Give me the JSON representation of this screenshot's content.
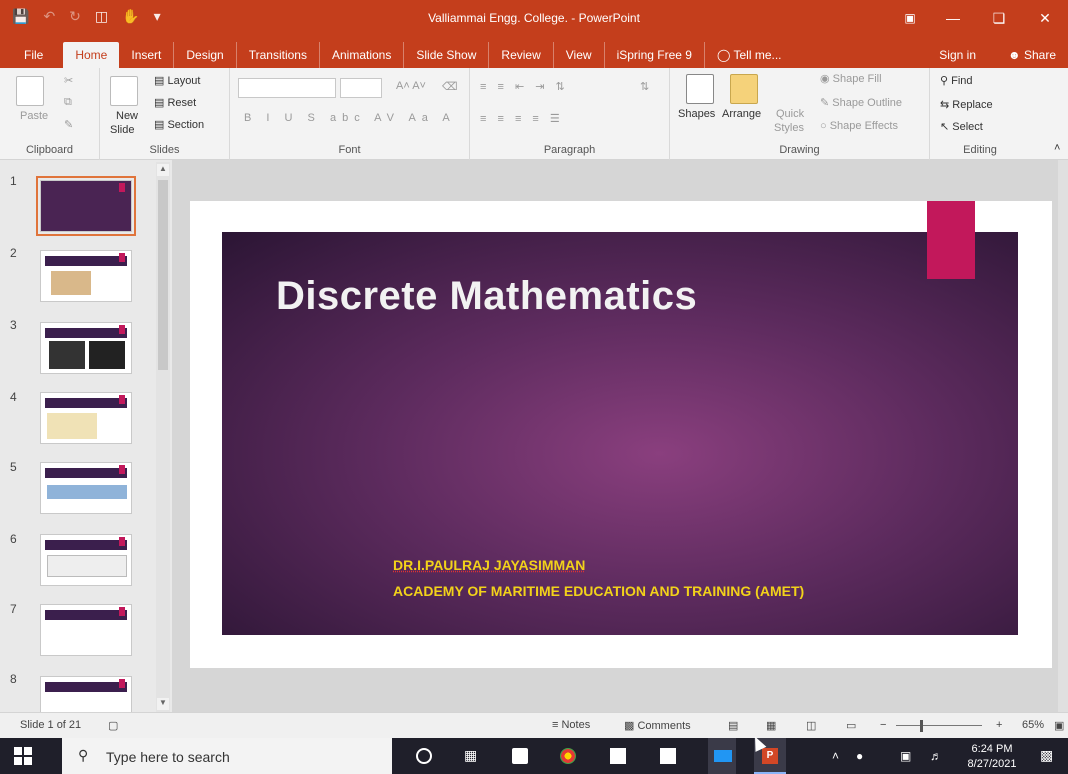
{
  "window": {
    "title": "Valliammai Engg. College. - PowerPoint",
    "controls": [
      "Ribbon display options",
      "Minimize",
      "Maximize",
      "Close"
    ]
  },
  "tabs": [
    "File",
    "Home",
    "Insert",
    "Design",
    "Transitions",
    "Animations",
    "Slide Show",
    "Review",
    "View",
    "iSpring Free 9",
    "Tell me..."
  ],
  "tabs_right": {
    "sign_in": "Sign in",
    "share": "Share"
  },
  "ribbon": {
    "clipboard": {
      "paste": "Paste",
      "label": "Clipboard"
    },
    "slides": {
      "new_slide": "New",
      "new_slide2": "Slide",
      "layout": "Layout",
      "reset": "Reset",
      "section": "Section",
      "label": "Slides"
    },
    "font": {
      "label": "Font",
      "bold": "B",
      "italic": "I",
      "underline": "U",
      "shadow": "S",
      "strike": "abc",
      "spacing": "AV",
      "case": "Aa",
      "color": "A"
    },
    "paragraph": {
      "label": "Paragraph"
    },
    "drawing": {
      "shapes": "Shapes",
      "arrange": "Arrange",
      "quick_styles": "Quick",
      "quick_styles2": "Styles",
      "shape_fill": "Shape Fill",
      "shape_outline": "Shape Outline",
      "shape_effects": "Shape Effects",
      "label": "Drawing"
    },
    "editing": {
      "find": "Find",
      "replace": "Replace",
      "select": "Select",
      "label": "Editing"
    }
  },
  "thumbnails": [
    "1",
    "2",
    "3",
    "4",
    "5",
    "6",
    "7",
    "8"
  ],
  "slide": {
    "title": "Discrete Mathematics",
    "author": "DR.I.PAULRAJ JAYASIMMAN",
    "institute": "ACADEMY OF MARITIME EDUCATION AND TRAINING (AMET)"
  },
  "statusbar": {
    "slide_counter": "Slide 1 of 21",
    "notes": "Notes",
    "comments": "Comments",
    "zoom": "65%"
  },
  "taskbar": {
    "search_placeholder": "Type here to search",
    "time": "6:24 PM",
    "date": "8/27/2021"
  },
  "colors": {
    "accent": "#c43e1c",
    "slide_pink": "#c2185b",
    "slide_text_yellow": "#f2d21a"
  }
}
